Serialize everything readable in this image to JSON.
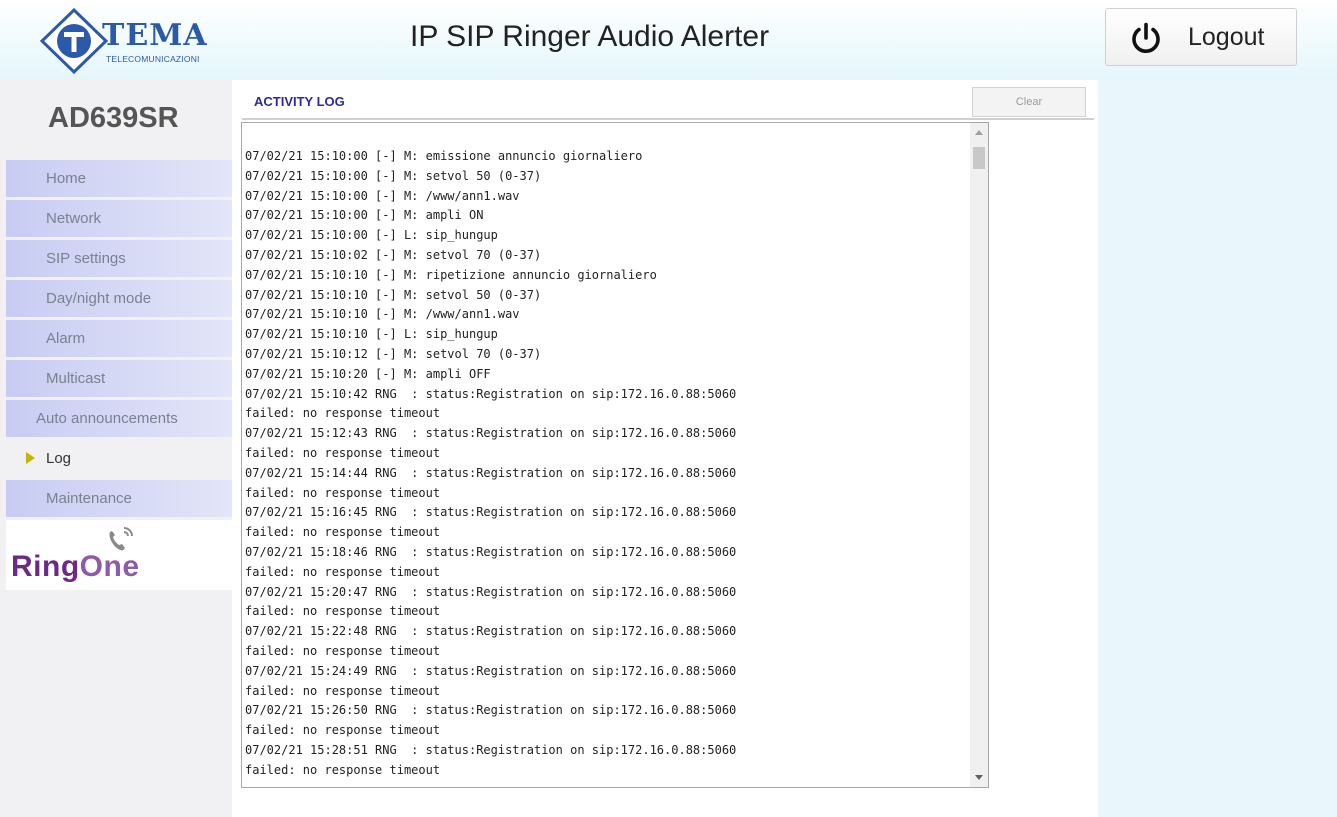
{
  "header": {
    "logo_text": "TEMA",
    "logo_subtext": "TELECOMUNICAZIONI",
    "logo_icon": "tema-t-diamond-logo",
    "title": "IP SIP Ringer Audio Alerter",
    "logout_label": "Logout",
    "logout_icon": "power-icon"
  },
  "sidebar": {
    "model": "AD639SR",
    "items": [
      {
        "label": "Home",
        "active": false
      },
      {
        "label": "Network",
        "active": false
      },
      {
        "label": "SIP settings",
        "active": false
      },
      {
        "label": "Day/night mode",
        "active": false
      },
      {
        "label": "Alarm",
        "active": false
      },
      {
        "label": "Multicast",
        "active": false
      },
      {
        "label": "Auto announcements",
        "active": false
      },
      {
        "label": "Log",
        "active": true
      },
      {
        "label": "Maintenance",
        "active": false
      }
    ],
    "active_marker_icon": "triangle-right-icon",
    "brand_part1": "Ring",
    "brand_part2": "One",
    "brand_icon": "phone-ringing-icon"
  },
  "main": {
    "section_title": "ACTIVITY LOG",
    "clear_label": "Clear",
    "log_lines": [
      "07/02/21 15:10:00 [-] M: emissione annuncio giornaliero",
      "07/02/21 15:10:00 [-] M: setvol 50 (0-37)",
      "07/02/21 15:10:00 [-] M: /www/ann1.wav",
      "07/02/21 15:10:00 [-] M: ampli ON",
      "07/02/21 15:10:00 [-] L: sip_hungup",
      "07/02/21 15:10:02 [-] M: setvol 70 (0-37)",
      "07/02/21 15:10:10 [-] M: ripetizione annuncio giornaliero",
      "07/02/21 15:10:10 [-] M: setvol 50 (0-37)",
      "07/02/21 15:10:10 [-] M: /www/ann1.wav",
      "07/02/21 15:10:10 [-] L: sip_hungup",
      "07/02/21 15:10:12 [-] M: setvol 70 (0-37)",
      "07/02/21 15:10:20 [-] M: ampli OFF",
      "07/02/21 15:10:42 RNG  : status:Registration on sip:172.16.0.88:5060",
      "failed: no response timeout",
      "07/02/21 15:12:43 RNG  : status:Registration on sip:172.16.0.88:5060",
      "failed: no response timeout",
      "07/02/21 15:14:44 RNG  : status:Registration on sip:172.16.0.88:5060",
      "failed: no response timeout",
      "07/02/21 15:16:45 RNG  : status:Registration on sip:172.16.0.88:5060",
      "failed: no response timeout",
      "07/02/21 15:18:46 RNG  : status:Registration on sip:172.16.0.88:5060",
      "failed: no response timeout",
      "07/02/21 15:20:47 RNG  : status:Registration on sip:172.16.0.88:5060",
      "failed: no response timeout",
      "07/02/21 15:22:48 RNG  : status:Registration on sip:172.16.0.88:5060",
      "failed: no response timeout",
      "07/02/21 15:24:49 RNG  : status:Registration on sip:172.16.0.88:5060",
      "failed: no response timeout",
      "07/02/21 15:26:50 RNG  : status:Registration on sip:172.16.0.88:5060",
      "failed: no response timeout",
      "07/02/21 15:28:51 RNG  : status:Registration on sip:172.16.0.88:5060",
      "failed: no response timeout"
    ]
  },
  "colors": {
    "header_gradient_end": "#e4f6fb",
    "nav_item": "#c8ccf2",
    "section_title": "#2d2a9e",
    "brand": "#6b2a8a",
    "active_marker": "#c7b400"
  }
}
